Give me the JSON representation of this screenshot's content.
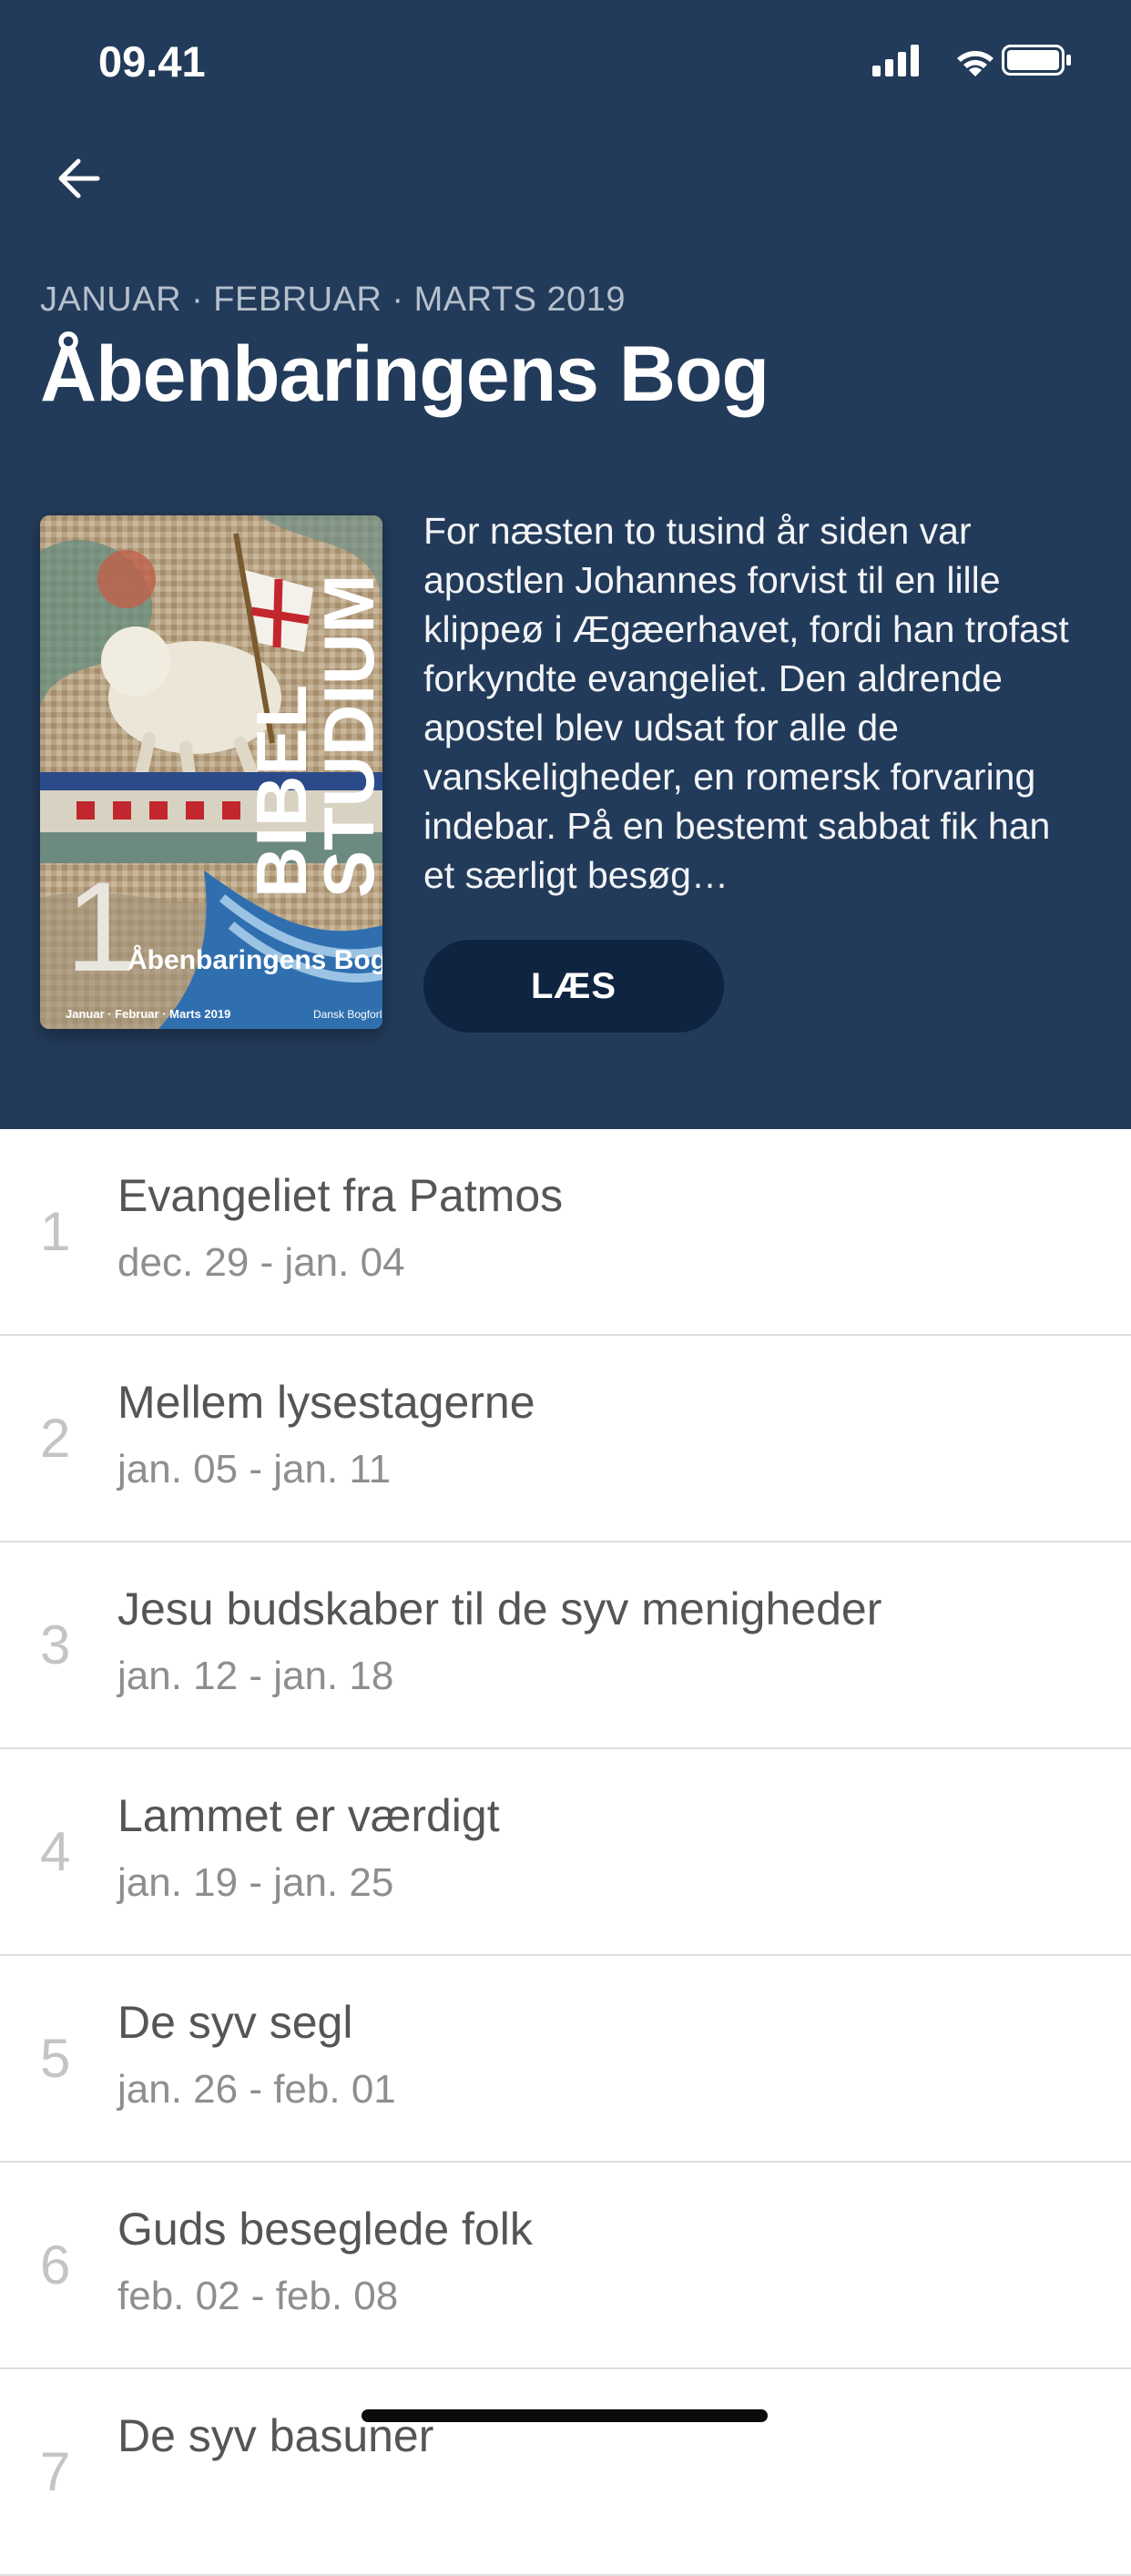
{
  "status_bar": {
    "time": "09.41"
  },
  "header": {
    "quarter_label": "JANUAR · FEBRUAR · MARTS 2019",
    "title": "Åbenbaringens Bog",
    "description": "For næsten to tusind år siden var apostlen Johannes forvist til en lille klippeø i Ægæerhavet, fordi han trofast forkyndte evangeliet. Den aldrende apostel blev udsat for alle de vanskeligheder, en romersk forvaring indebar. På en bestemt sabbat fik han et særligt besøg…",
    "read_button": "LÆS",
    "colors": {
      "background": "#233b5a",
      "button": "#0e2440"
    }
  },
  "cover": {
    "series_line1": "BIBEL",
    "series_line2": "STUDIUM",
    "issue_number": "1",
    "book_title": "Åbenbaringens Bog",
    "period": "Januar · Februar · Marts 2019",
    "publisher": "Dansk Bogforlag"
  },
  "lessons": [
    {
      "number": "1",
      "title": "Evangeliet fra Patmos",
      "dates": "dec. 29 - jan. 04"
    },
    {
      "number": "2",
      "title": "Mellem lysestagerne",
      "dates": "jan. 05 - jan. 11"
    },
    {
      "number": "3",
      "title": "Jesu budskaber til de syv menigheder",
      "dates": "jan. 12 - jan. 18"
    },
    {
      "number": "4",
      "title": "Lammet er værdigt",
      "dates": "jan. 19 - jan. 25"
    },
    {
      "number": "5",
      "title": "De syv segl",
      "dates": "jan. 26 - feb. 01"
    },
    {
      "number": "6",
      "title": "Guds beseglede folk",
      "dates": "feb. 02 - feb. 08"
    },
    {
      "number": "7",
      "title": "De syv basuner",
      "dates": ""
    }
  ]
}
